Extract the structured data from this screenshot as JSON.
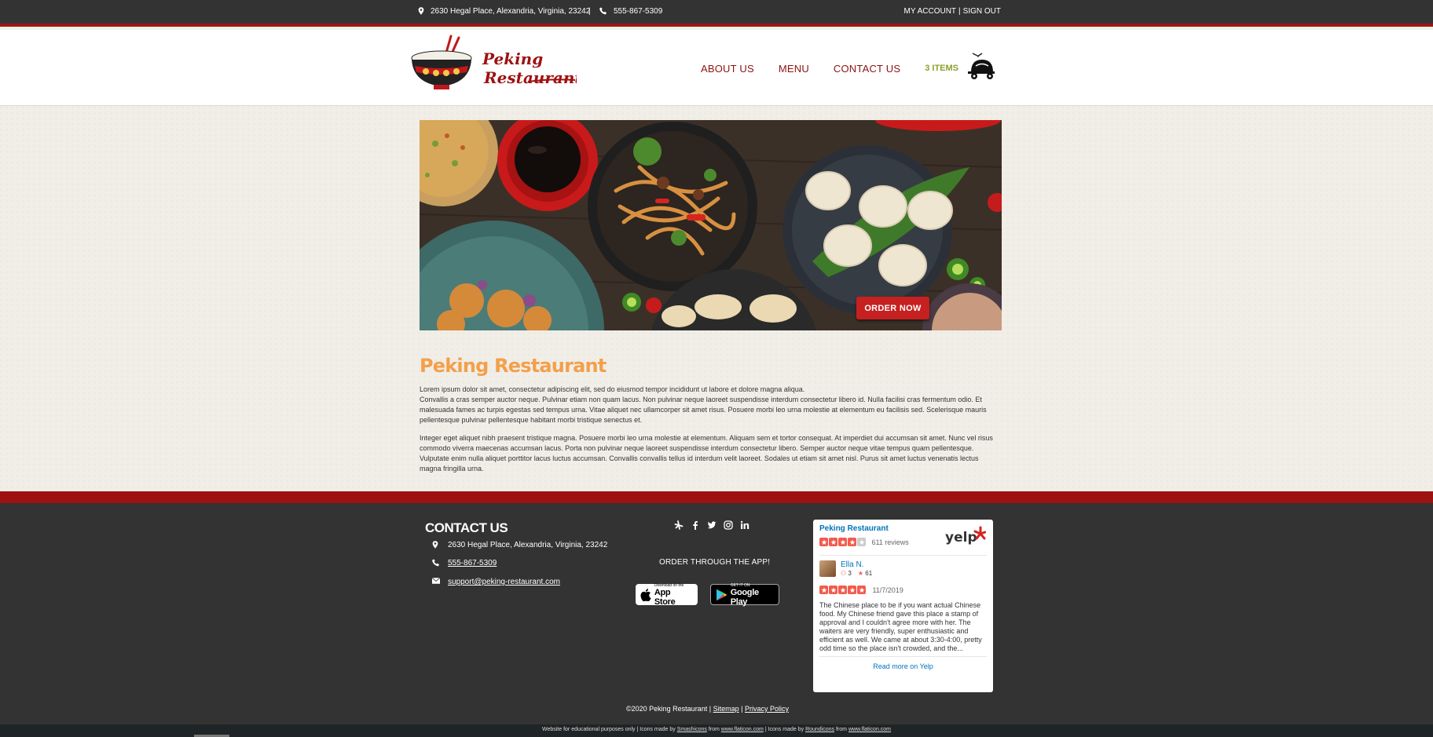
{
  "topbar": {
    "address": "2630 Hegal Place, Alexandria, Virginia, 23242",
    "separator": "|",
    "phone": "555-867-5309",
    "my_account": "MY ACCOUNT",
    "account_sep": "|",
    "sign_out": "SIGN OUT"
  },
  "header": {
    "logo_line1": "Peking",
    "logo_line2": "Restaurant",
    "nav": [
      "ABOUT US",
      "MENU",
      "CONTACT US"
    ],
    "cart_items": "3 ITEMS",
    "cart_icon": "delivery-scooter-icon"
  },
  "hero": {
    "order_button": "ORDER NOW"
  },
  "main": {
    "title": "Peking Restaurant",
    "para1_line1": "Lorem ipsum dolor sit amet, consectetur adipiscing elit, sed do eiusmod tempor incididunt ut labore et dolore magna aliqua.",
    "para1_line2": "Convallis a cras semper auctor neque. Pulvinar etiam non quam lacus. Non pulvinar neque laoreet suspendisse interdum consectetur libero id. Nulla facilisi cras fermentum odio. Et malesuada fames ac turpis egestas sed tempus urna. Vitae aliquet nec ullamcorper sit amet risus. Posuere morbi leo urna molestie at elementum eu facilisis sed. Scelerisque mauris pellentesque pulvinar pellentesque habitant morbi tristique senectus et.",
    "para2": "Integer eget aliquet nibh praesent tristique magna. Posuere morbi leo urna molestie at elementum. Aliquam sem et tortor consequat. At imperdiet dui accumsan sit amet. Nunc vel risus commodo viverra maecenas accumsan lacus. Porta non pulvinar neque laoreet suspendisse interdum consectetur libero. Semper auctor neque vitae tempus quam pellentesque. Vulputate enim nulla aliquet porttitor lacus luctus accumsan. Convallis convallis tellus id interdum velit laoreet. Sodales ut etiam sit amet nisl. Purus sit amet luctus venenatis lectus magna fringilla urna."
  },
  "footer": {
    "contact_title": "CONTACT US",
    "address": "2630 Hegal Place, Alexandria, Virginia, 23242",
    "phone": "555-867-5309",
    "email": "support@peking-restaurant.com",
    "socials": [
      "yelp-icon",
      "facebook-icon",
      "twitter-icon",
      "instagram-icon",
      "linkedin-icon"
    ],
    "order_app": "ORDER THROUGH THE APP!",
    "appstore_small": "Download on the",
    "appstore_big": "App Store",
    "gplay_small": "GET IT ON",
    "gplay_big": "Google Play",
    "copyright": "©2020 Peking Restaurant |",
    "sitemap": "Sitemap",
    "copy_sep": "|",
    "privacy": "Privacy Policy",
    "credit_pre": "Website for educational purposes only | Icons made by",
    "credit_a1": "Smashicons",
    "credit_from1": "from",
    "credit_a2": "www.flaticon.com",
    "credit_mid": "| Icons made by",
    "credit_a3": "Roundicons",
    "credit_from2": "from",
    "credit_a4": "www.flaticon.com"
  },
  "yelp": {
    "business": "Peking Restaurant",
    "logo_text": "yelp",
    "rating": 4,
    "reviews": "611 reviews",
    "reviewer": "Ella N.",
    "friends": "3",
    "review_count": "61",
    "review_rating": 5,
    "date": "11/7/2019",
    "text": "The Chinese place to be if you want actual Chinese food. My Chinese friend gave this place a stamp of approval and I couldn't agree more with her. The waiters are very friendly, super enthusiastic and efficient as well. We came at about 3:30-4:00, pretty odd time so the place isn't crowded, and the...",
    "read_more": "Read more on Yelp"
  },
  "colors": {
    "brand_red": "#9e1111",
    "title_orange": "#f3a04a",
    "cart_green": "#8aa12b",
    "dark_bg": "#333333",
    "yelp_red": "#f15c4f"
  }
}
